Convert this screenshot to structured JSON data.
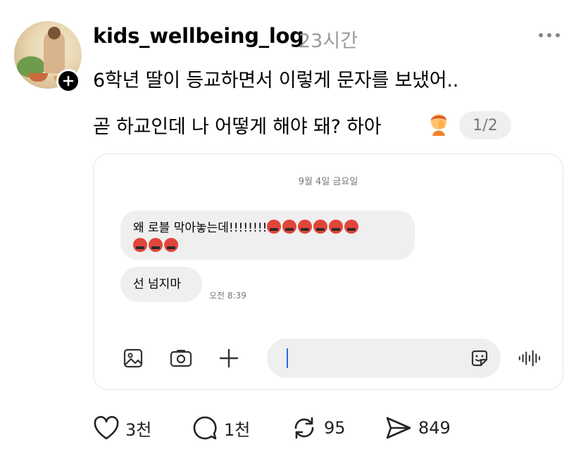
{
  "post": {
    "username": "kids_wellbeing_log",
    "time": "23시간",
    "line1": "6학년 딸이 등교하면서 이렇게 문자를 보냈어..",
    "line2": "곧 하교인데 나 어떻게 해야 돼? 하아",
    "image_counter": "1/2"
  },
  "screenshot": {
    "date": "9월 4일 금요일",
    "message1_text": "왜 로블 막아놓는데!!!!!!!!",
    "message1_emoji_count_line1": 6,
    "message1_emoji_count_line2": 3,
    "message2_text": "선 넘지마",
    "message_time": "오전 8:39",
    "input_value": ""
  },
  "actions": {
    "likes": "3천",
    "comments": "1천",
    "reposts": "95",
    "shares": "849"
  },
  "icons": {
    "more": "more-horizontal-icon",
    "follow": "plus-icon",
    "emoji": "face-palm-emoji",
    "gallery": "image-icon",
    "camera": "camera-icon",
    "add": "plus-icon",
    "sticker": "sticker-icon",
    "voice": "voice-wave-icon",
    "like": "heart-icon",
    "comment": "comment-icon",
    "repost": "repost-icon",
    "share": "send-icon"
  },
  "colors": {
    "caret": "#2a6bd8",
    "muted": "#9a9a9a",
    "bubble": "#efefef"
  }
}
